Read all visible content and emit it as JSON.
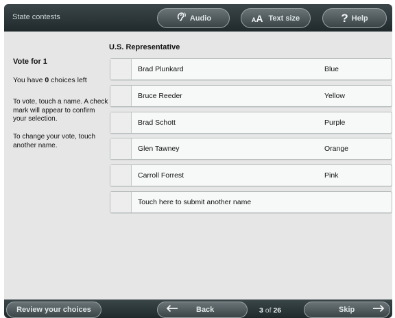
{
  "header": {
    "section_title": "State contests",
    "audio_label": "Audio",
    "text_size_small": "A",
    "text_size_big": "A",
    "text_size_label": "Text size",
    "help_glyph": "?",
    "help_label": "Help"
  },
  "sidebar": {
    "vote_for": "Vote for 1",
    "choices_prefix": "You have ",
    "choices_count": "0",
    "choices_suffix": " choices left",
    "instructions_1": "To vote, touch a name. A check mark will appear to confirm your selection.",
    "instructions_2": "To change your vote, touch another name."
  },
  "contest": {
    "title": "U.S. Representative",
    "candidates": [
      {
        "name": "Brad Plunkard",
        "party": "Blue"
      },
      {
        "name": "Bruce Reeder",
        "party": "Yellow"
      },
      {
        "name": "Brad Schott",
        "party": "Purple"
      },
      {
        "name": "Glen Tawney",
        "party": "Orange"
      },
      {
        "name": "Carroll Forrest",
        "party": "Pink"
      }
    ],
    "write_in_label": "Touch here to submit another name"
  },
  "footer": {
    "review_label": "Review your choices",
    "back_label": "Back",
    "page_current": "3",
    "page_of": " of ",
    "page_total": "26",
    "skip_label": "Skip"
  },
  "icons": {
    "audio": "ear-icon",
    "text_size": "text-size-icon",
    "help": "question-mark-icon",
    "back": "left-arrow-icon",
    "skip": "right-arrow-icon"
  }
}
